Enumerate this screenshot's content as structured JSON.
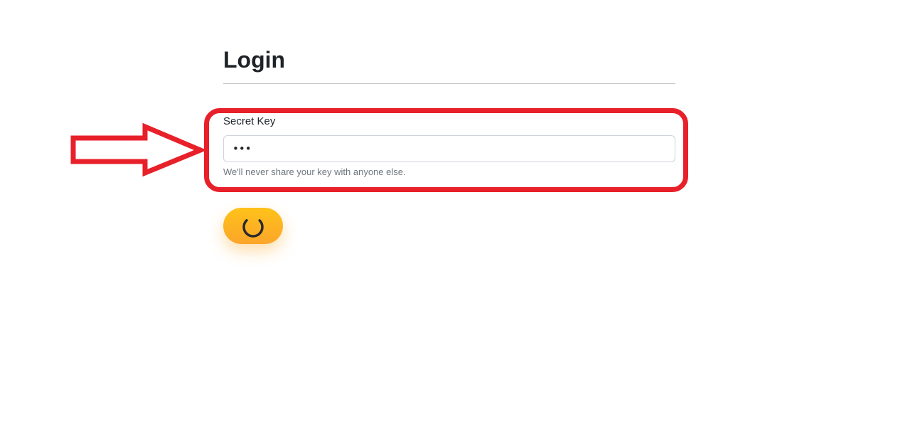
{
  "form": {
    "title": "Login",
    "field_label": "Secret Key",
    "key_value": "•••",
    "help_text": "We'll never share your key with anyone else."
  },
  "submit_button": {
    "state": "loading",
    "icon": "spinner-icon"
  },
  "annotation": {
    "arrow_icon": "right-arrow-outline-icon",
    "color": "#e8202a"
  },
  "colors": {
    "button_top": "#ffc21a",
    "button_bottom": "#fba52a",
    "annotation_red": "#e8202a"
  }
}
